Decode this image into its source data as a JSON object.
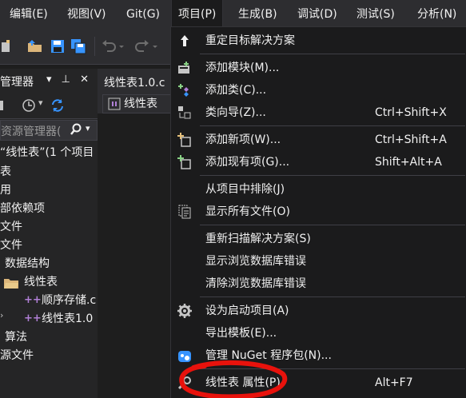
{
  "menubar": {
    "items": [
      "编辑(E)",
      "视图(V)",
      "Git(G)",
      "项目(P)",
      "生成(B)",
      "调试(D)",
      "测试(S)",
      "分析(N)"
    ]
  },
  "solution_panel": {
    "title": "管理器",
    "search_placeholder": "资源管理器(",
    "items": [
      "“线性表”(1 个项目",
      "表",
      "用",
      "部依赖项",
      "文件",
      "文件",
      "数据结构",
      "线性表",
      "顺序存储.c",
      "线性表1.0",
      "算法",
      "源文件"
    ]
  },
  "editor": {
    "tab_label": "线性表1.0.c",
    "dropdown_label": "线性表"
  },
  "project_menu": {
    "items": [
      {
        "label": "重定目标解决方案",
        "shortcut": "",
        "icon": "retarget-arrow-icon"
      },
      {
        "label": "添加模块(M)...",
        "shortcut": "",
        "icon": "add-module-icon"
      },
      {
        "label": "添加类(C)...",
        "shortcut": "",
        "icon": "add-class-icon"
      },
      {
        "label": "类向导(Z)...",
        "shortcut": "Ctrl+Shift+X",
        "icon": "class-wizard-icon"
      },
      {
        "label": "添加新项(W)...",
        "shortcut": "Ctrl+Shift+A",
        "icon": "add-new-item-icon"
      },
      {
        "label": "添加现有项(G)...",
        "shortcut": "Shift+Alt+A",
        "icon": "add-existing-item-icon"
      },
      {
        "label": "从项目中排除(J)",
        "shortcut": "",
        "icon": ""
      },
      {
        "label": "显示所有文件(O)",
        "shortcut": "",
        "icon": "show-all-files-icon"
      },
      {
        "label": "重新扫描解决方案(S)",
        "shortcut": "",
        "icon": ""
      },
      {
        "label": "显示浏览数据库错误",
        "shortcut": "",
        "icon": ""
      },
      {
        "label": "清除浏览数据库错误",
        "shortcut": "",
        "icon": ""
      },
      {
        "label": "设为启动项目(A)",
        "shortcut": "",
        "icon": "gear-icon"
      },
      {
        "label": "导出模板(E)...",
        "shortcut": "",
        "icon": ""
      },
      {
        "label": "管理 NuGet 程序包(N)...",
        "shortcut": "",
        "icon": "nuget-icon"
      },
      {
        "label": "线性表 属性(P)",
        "shortcut": "Alt+F7",
        "icon": "wrench-icon"
      }
    ]
  },
  "colors": {
    "background": "#1e1e1e",
    "menu_bg": "#1b1b1c",
    "chrome": "#2d2d30",
    "annotation_red": "#e8120c",
    "icon_green": "#89d185",
    "icon_blue": "#3794ff"
  }
}
